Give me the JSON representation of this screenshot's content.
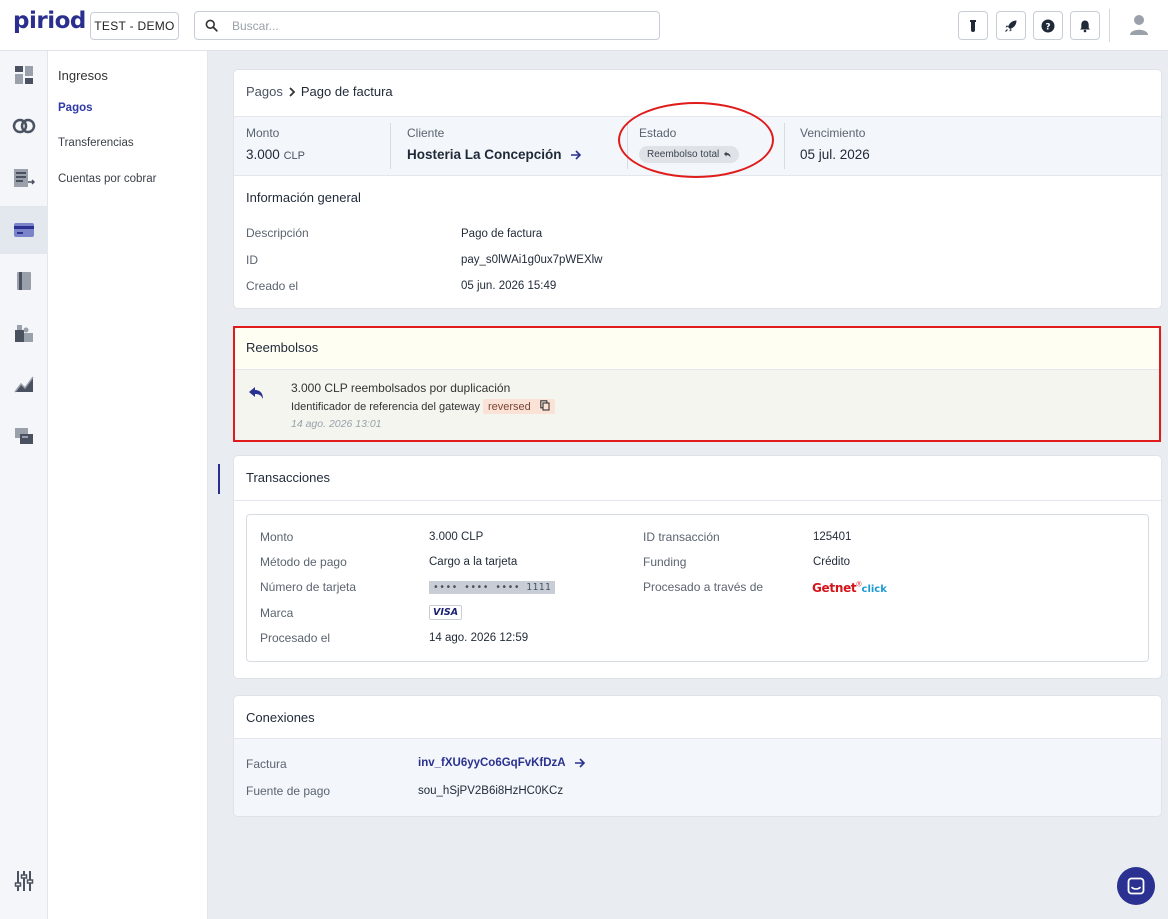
{
  "brand": {
    "logo_text": "piriod",
    "logo_color": "#2a2f8f"
  },
  "header": {
    "environment_label": "TEST - DEMO",
    "search_placeholder": "Buscar...",
    "icons": [
      "test-tube-icon",
      "rocket-icon",
      "help-icon",
      "bell-icon",
      "user-icon"
    ]
  },
  "rail": {
    "items": [
      "dashboard-icon",
      "integrations-icon",
      "invoices-icon",
      "payments-icon",
      "book-icon",
      "puzzle-icon",
      "reports-icon",
      "transfers-icon",
      "settings-icon"
    ],
    "active": "payments-icon"
  },
  "subnav": {
    "title": "Ingresos",
    "items": [
      {
        "label": "Pagos",
        "active": true
      },
      {
        "label": "Transferencias",
        "active": false
      },
      {
        "label": "Cuentas por cobrar",
        "active": false
      }
    ]
  },
  "payment": {
    "breadcrumb": {
      "parent": "Pagos",
      "current": "Pago de factura"
    },
    "stats": {
      "amount_label": "Monto",
      "amount_value": "3.000",
      "amount_currency": "CLP",
      "client_label": "Cliente",
      "client_value": "Hosteria La Concepción",
      "status_label": "Estado",
      "status_value": "Reembolso total",
      "due_label": "Vencimiento",
      "due_value": "05 jul. 2026"
    },
    "general": {
      "title": "Información general",
      "rows": [
        {
          "label": "Descripción",
          "value": "Pago de factura"
        },
        {
          "label": "ID",
          "value": "pay_s0lWAi1g0ux7pWEXlw"
        },
        {
          "label": "Creado el",
          "value": "05 jun. 2026 15:49"
        }
      ]
    }
  },
  "refunds": {
    "title": "Reembolsos",
    "item": {
      "summary": "3.000 CLP reembolsados por duplicación",
      "gateway_label": "Identificador de referencia del gateway",
      "gateway_value": "reversed",
      "timestamp": "14 ago. 2026 13:01"
    }
  },
  "transactions": {
    "title": "Transacciones",
    "amount_label": "Monto",
    "amount_value": "3.000 CLP",
    "method_label": "Método de pago",
    "method_value": "Cargo a la tarjeta",
    "card_label": "Número de tarjeta",
    "card_value": "•••• •••• •••• 1111",
    "brand_label": "Marca",
    "brand_value": "VISA",
    "processed_label": "Procesado el",
    "processed_value": "14 ago. 2026 12:59",
    "txid_label": "ID transacción",
    "txid_value": "125401",
    "funding_label": "Funding",
    "funding_value": "Crédito",
    "via_label": "Procesado a través de",
    "via_value": "Getnet",
    "via_suffix": "click"
  },
  "connections": {
    "title": "Conexiones",
    "invoice_label": "Factura",
    "invoice_value": "inv_fXU6yyCo6GqFvKfDzA",
    "source_label": "Fuente de pago",
    "source_value": "sou_hSjPV2B6i8HzHC0KCz"
  },
  "colors": {
    "accent": "#2a3190",
    "highlight": "#e01b1b",
    "getnet": "#d4141b"
  }
}
